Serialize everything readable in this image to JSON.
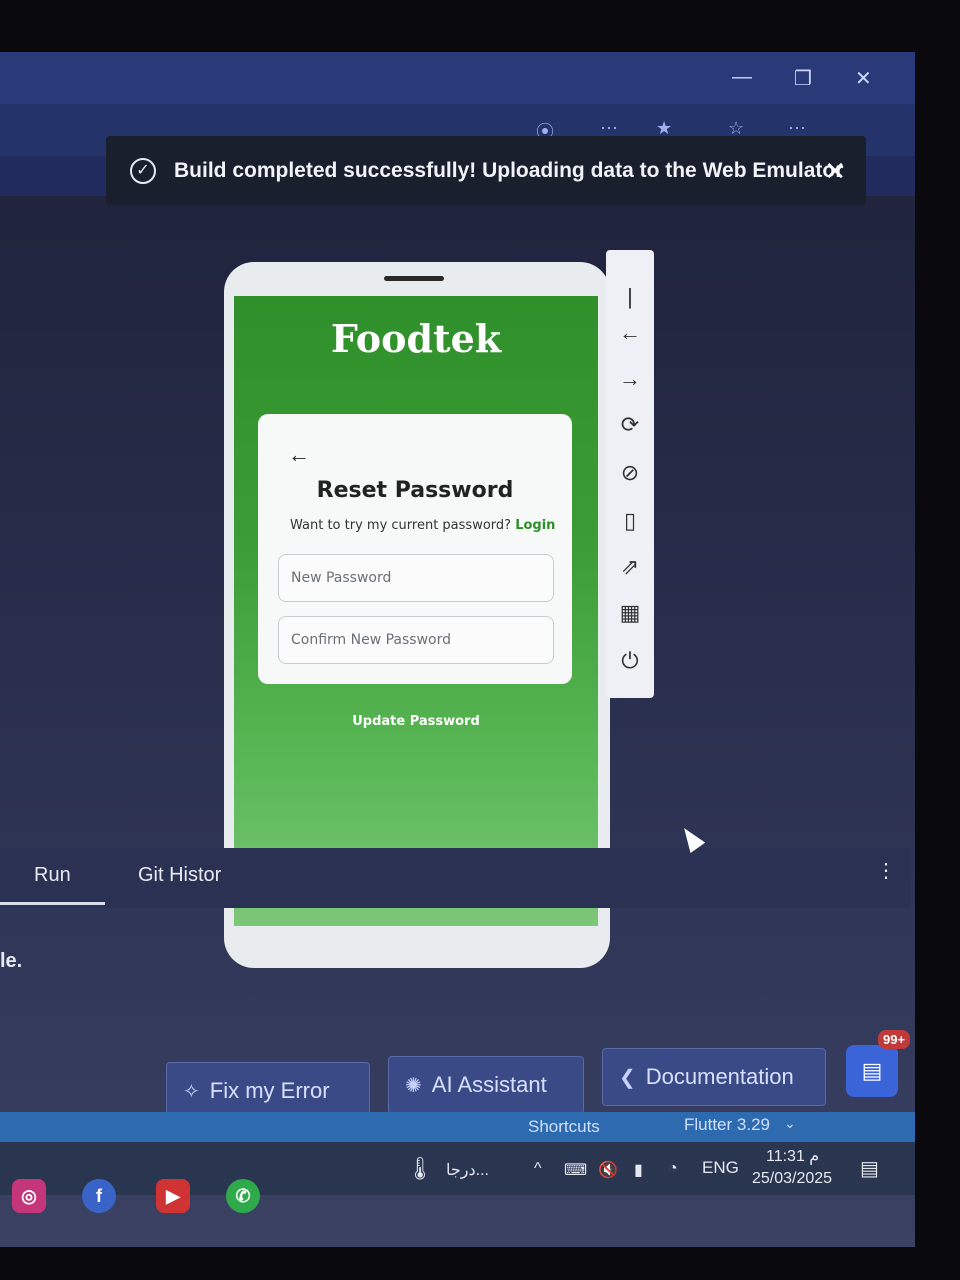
{
  "toast": {
    "message": "Build completed successfully! Uploading data to the Web Emulator",
    "check_icon": "check-circle-icon",
    "close_icon": "close-icon"
  },
  "app": {
    "logo": "Foodtek",
    "card": {
      "title": "Reset Password",
      "subtitle": "Want to try my current password?",
      "link": "Login",
      "new_password_placeholder": "New Password",
      "confirm_password_placeholder": "Confirm New Password"
    },
    "update_button": "Update Password"
  },
  "ide_tabs": [
    "Run",
    "Git Histor"
  ],
  "partial_text": "le.",
  "pills": {
    "fix": "Fix my Error",
    "ai": "AI Assistant",
    "docs": "Documentation"
  },
  "badge": "99+",
  "statusbar": {
    "shortcuts": "Shortcuts",
    "flutter": "Flutter 3.29"
  },
  "taskbar": {
    "weather": "درجا...",
    "lang": "ENG",
    "time": "11:31 م",
    "date": "25/03/2025"
  },
  "colors": {
    "app_green": "#3c9d36",
    "toast_bg": "#1a1f2e",
    "pill_bg": "#3a4a86"
  }
}
